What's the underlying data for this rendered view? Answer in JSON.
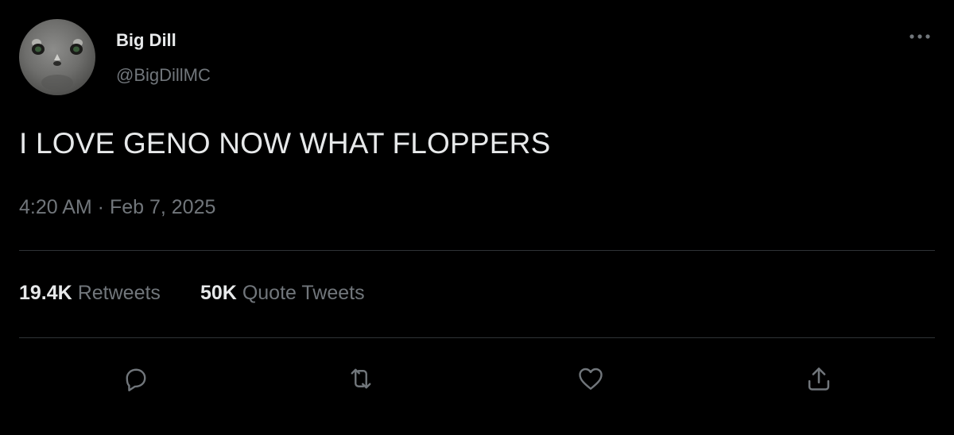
{
  "tweet": {
    "author": {
      "display_name": "Big Dill",
      "handle": "@BigDillMC"
    },
    "text": "I LOVE GENO NOW WHAT FLOPPERS",
    "timestamp": "4:20 AM · Feb 7, 2025",
    "stats": {
      "retweets_count": "19.4K",
      "retweets_label": "Retweets",
      "quotes_count": "50K",
      "quotes_label": "Quote Tweets"
    }
  },
  "icons": {
    "more": "more-horizontal-icon",
    "reply": "reply-icon",
    "retweet": "retweet-icon",
    "like": "heart-icon",
    "share": "share-icon"
  },
  "colors": {
    "background": "#000000",
    "primary_text": "#e7e9ea",
    "secondary_text": "#71767b",
    "divider": "#2f3336"
  }
}
